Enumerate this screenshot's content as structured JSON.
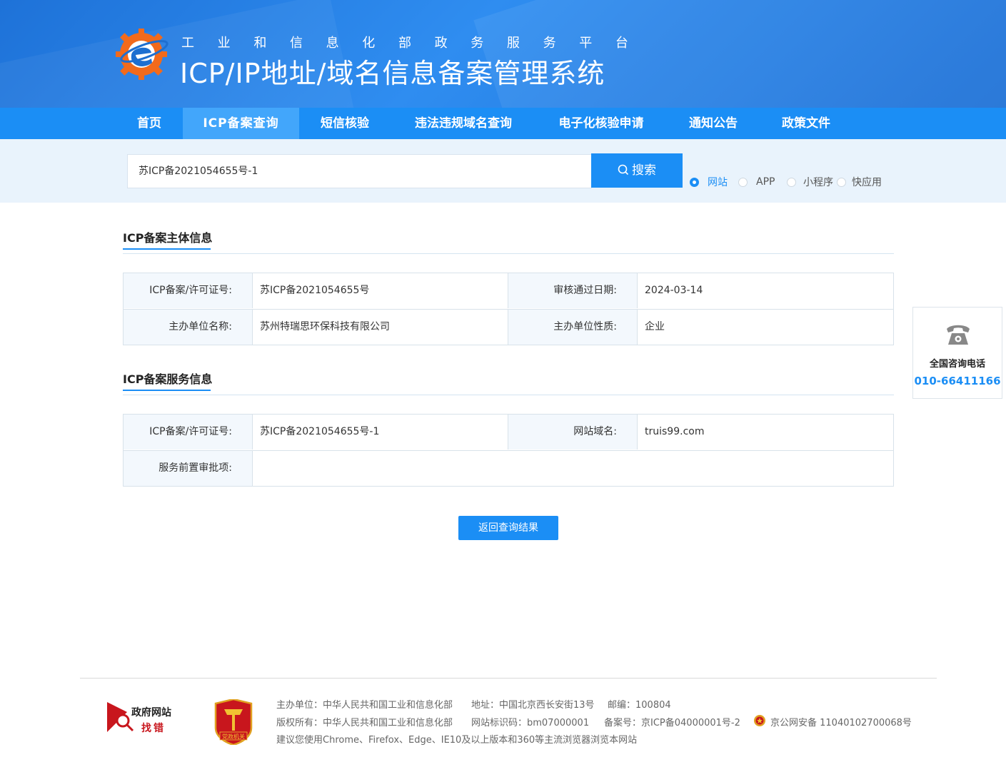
{
  "header": {
    "subtitle_chars": [
      "工",
      "业",
      "和",
      "信",
      "息",
      "化",
      "部",
      "政",
      "务",
      "服",
      "务",
      "平",
      "台"
    ],
    "title": "ICP/IP地址/域名信息备案管理系统"
  },
  "nav": {
    "items": [
      {
        "label": "首页"
      },
      {
        "label": "ICP备案查询",
        "active": true
      },
      {
        "label": "短信核验"
      },
      {
        "label": "违法违规域名查询"
      },
      {
        "label": "电子化核验申请"
      },
      {
        "label": "通知公告"
      },
      {
        "label": "政策文件"
      }
    ]
  },
  "search": {
    "value": "苏ICP备2021054655号-1",
    "button_label": "搜索",
    "types": [
      {
        "label": "网站",
        "checked": true
      },
      {
        "label": "APP",
        "checked": false
      },
      {
        "label": "小程序",
        "checked": false
      },
      {
        "label": "快应用",
        "checked": false
      }
    ]
  },
  "subject_section": {
    "title": "ICP备案主体信息",
    "rows": [
      [
        {
          "label": "ICP备案/许可证号:",
          "value": "苏ICP备2021054655号"
        },
        {
          "label": "审核通过日期:",
          "value": "2024-03-14"
        }
      ],
      [
        {
          "label": "主办单位名称:",
          "value": "苏州特瑞思环保科技有限公司"
        },
        {
          "label": "主办单位性质:",
          "value": "企业"
        }
      ]
    ]
  },
  "service_section": {
    "title": "ICP备案服务信息",
    "row1": [
      {
        "label": "ICP备案/许可证号:",
        "value": "苏ICP备2021054655号-1"
      },
      {
        "label": "网站域名:",
        "value": "truis99.com"
      }
    ],
    "row2": {
      "label": "服务前置审批项:",
      "value": ""
    }
  },
  "back_button": "返回查询结果",
  "consult": {
    "label": "全国咨询电话",
    "number": "010-66411166"
  },
  "footer": {
    "gov_site_line1": "政府网站",
    "gov_site_line2": "找错",
    "party_badge": "党政机关",
    "line1": [
      "主办单位：中华人民共和国工业和信息化部",
      "地址：中国北京西长安街13号",
      "邮编：100804"
    ],
    "line2": [
      "版权所有：中华人民共和国工业和信息化部",
      "网站标识码：bm07000001",
      "备案号：京ICP备04000001号-2",
      "京公网安备 11040102700068号"
    ],
    "line3": "建议您使用Chrome、Firefox、Edge、IE10及以上版本和360等主流浏览器浏览本网站"
  },
  "colors": {
    "primary": "#1b8ef5",
    "nav_active": "#42a6fb",
    "label_bg": "#f3f8fd",
    "logo_orange": "#f26a1b"
  }
}
